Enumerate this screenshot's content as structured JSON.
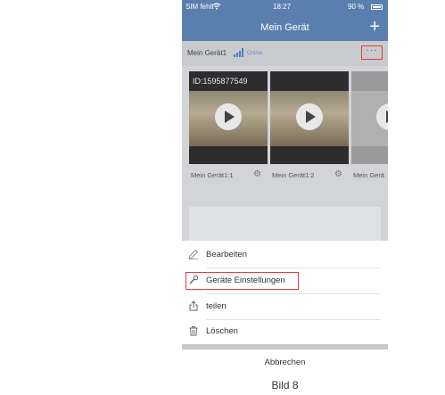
{
  "status_bar": {
    "carrier": "SIM fehlt",
    "time": "18:27",
    "battery": "90 %"
  },
  "navbar": {
    "title": "Mein Gerät",
    "add_icon": "+"
  },
  "device": {
    "name": "Mein Gerät1",
    "status": "Online",
    "more_icon": "···",
    "camera_id": "ID:1595877549",
    "cameras": [
      {
        "label": "Mein Gerät1:1"
      },
      {
        "label": "Mein Gerät1:2"
      },
      {
        "label": "Mein Gerä"
      }
    ]
  },
  "action_sheet": {
    "items": [
      {
        "label": "Bearbeiten",
        "icon": "pencil-icon"
      },
      {
        "label": "Geräte Einstellungen",
        "icon": "wrench-icon"
      },
      {
        "label": "teilen",
        "icon": "share-icon"
      },
      {
        "label": "Löschen",
        "icon": "trash-icon"
      }
    ],
    "cancel_label": "Abbrechen"
  },
  "caption": "Bild 8",
  "colors": {
    "navbar": "#5a7fae",
    "highlight": "#e23b3b",
    "signal": "#4a7fd1"
  }
}
